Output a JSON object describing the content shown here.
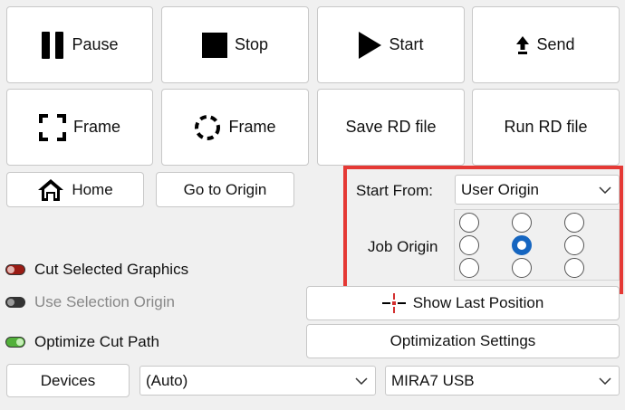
{
  "toolbar": {
    "pause": "Pause",
    "stop": "Stop",
    "start": "Start",
    "send": "Send",
    "frame_square": "Frame",
    "frame_circle": "Frame",
    "save_rd": "Save RD file",
    "run_rd": "Run RD file"
  },
  "nav": {
    "home": "Home",
    "go_to_origin": "Go to Origin"
  },
  "origin": {
    "start_from_label": "Start From:",
    "start_from_value": "User Origin",
    "job_origin_label": "Job Origin",
    "selected_cell": {
      "row": 1,
      "col": 1
    }
  },
  "options": {
    "cut_selected": "Cut Selected Graphics",
    "use_selection_origin": "Use Selection Origin",
    "optimize_cut_path": "Optimize Cut Path"
  },
  "actions": {
    "show_last_position": "Show Last Position",
    "optimization_settings": "Optimization Settings"
  },
  "devices": {
    "button": "Devices",
    "port": "(Auto)",
    "device": "MIRA7 USB"
  },
  "colors": {
    "highlight_box": "#e53935",
    "radio_selected": "#1565c0",
    "toggle_red": "#9a1b14",
    "toggle_green": "#52b03a"
  }
}
